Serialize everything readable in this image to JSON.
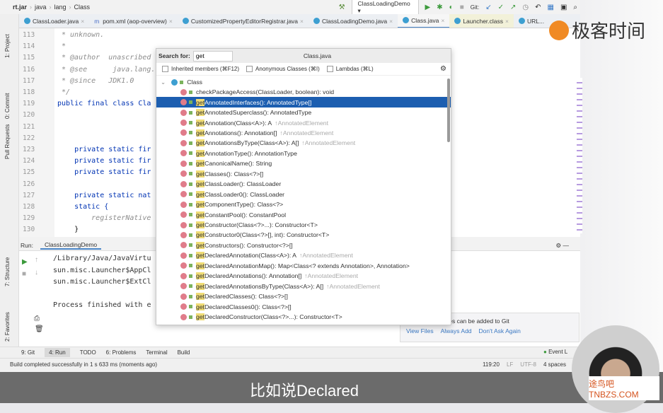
{
  "breadcrumb": [
    "rt.jar",
    "java",
    "lang",
    "Class"
  ],
  "toolbar": {
    "run_config": "ClassLoadingDemo ▾",
    "git_label": "Git:"
  },
  "tabs": [
    "ClassLoader.java",
    "pom.xml (aop-overview)",
    "CustomizedPropertyEditorRegistrar.java",
    "ClassLoadingDemo.java",
    "Class.java",
    "Launcher.class",
    "URL..."
  ],
  "side_tools": [
    "1: Project",
    "0: Commit",
    "Pull Requests",
    "7: Structure",
    "2: Favorites"
  ],
  "code": [
    {
      "n": "113",
      "t": "* unknown.",
      "c": "cm"
    },
    {
      "n": "114",
      "t": "*",
      "c": "cm"
    },
    {
      "n": "115",
      "t": "* @author  unascribed",
      "c": "cm"
    },
    {
      "n": "116",
      "t": "* @see      java.lang.",
      "c": "cm"
    },
    {
      "n": "117",
      "t": "* @since   JDK1.0",
      "c": "cm"
    },
    {
      "n": "118",
      "t": "*/",
      "c": "cm"
    },
    {
      "n": "119",
      "t": "public final class Cla",
      "c": "kw0"
    },
    {
      "n": "120",
      "t": "",
      "c": ""
    },
    {
      "n": "121",
      "t": "",
      "c": ""
    },
    {
      "n": "122",
      "t": "",
      "c": ""
    },
    {
      "n": "123",
      "t": "    private static fir",
      "c": "kw"
    },
    {
      "n": "124",
      "t": "    private static fir",
      "c": "kw"
    },
    {
      "n": "125",
      "t": "    private static fir",
      "c": "kw"
    },
    {
      "n": "126",
      "t": "",
      "c": ""
    },
    {
      "n": "127",
      "t": "    private static nat",
      "c": "kw"
    },
    {
      "n": "128",
      "t": "    static {",
      "c": "kw"
    },
    {
      "n": "129",
      "t": "        registerNative",
      "c": "cm"
    },
    {
      "n": "130",
      "t": "    }",
      "c": ""
    }
  ],
  "run": {
    "label": "Run:",
    "tab": "ClassLoadingDemo",
    "output": [
      "/Library/Java/JavaVirtu",
      "sun.misc.Launcher$AppCl",
      "sun.misc.Launcher$ExtCl",
      "",
      "Process finished with e"
    ]
  },
  "bottom_tools": [
    "9: Git",
    "4: Run",
    "TODO",
    "6: Problems",
    "Terminal",
    "Build"
  ],
  "event_log": "Event L",
  "status": {
    "message": "Build completed successfully in 1 s 633 ms (moments ago)",
    "position": "119:20",
    "line_sep": "LF",
    "encoding": "UTF-8",
    "indent": "4 spaces"
  },
  "popup": {
    "search_label": "Search for:",
    "search_value": "get",
    "file": "Class.java",
    "checks": [
      "Inherited members (⌘F12)",
      "Anonymous Classes (⌘I)",
      "Lambdas (⌘L)"
    ],
    "root": "Class",
    "items": [
      {
        "name": "checkPackageAccess(ClassLoader, boolean): void",
        "hl": "",
        "inh": ""
      },
      {
        "hl": "get",
        "name": "AnnotatedInterfaces(): AnnotatedType[]",
        "inh": "",
        "sel": true
      },
      {
        "hl": "get",
        "name": "AnnotatedSuperclass(): AnnotatedType",
        "inh": ""
      },
      {
        "hl": "get",
        "name": "Annotation(Class<A>): A",
        "inh": "↑AnnotatedElement"
      },
      {
        "hl": "get",
        "name": "Annotations(): Annotation[]",
        "inh": "↑AnnotatedElement"
      },
      {
        "hl": "get",
        "name": "AnnotationsByType(Class<A>): A[]",
        "inh": "↑AnnotatedElement"
      },
      {
        "hl": "get",
        "name": "AnnotationType(): AnnotationType",
        "inh": ""
      },
      {
        "hl": "get",
        "name": "CanonicalName(): String",
        "inh": ""
      },
      {
        "hl": "get",
        "name": "Classes(): Class<?>[]",
        "inh": ""
      },
      {
        "hl": "get",
        "name": "ClassLoader(): ClassLoader",
        "inh": ""
      },
      {
        "hl": "get",
        "name": "ClassLoader0(): ClassLoader",
        "inh": ""
      },
      {
        "hl": "get",
        "name": "ComponentType(): Class<?>",
        "inh": ""
      },
      {
        "hl": "get",
        "name": "ConstantPool(): ConstantPool",
        "inh": ""
      },
      {
        "hl": "get",
        "name": "Constructor(Class<?>...): Constructor<T>",
        "inh": ""
      },
      {
        "hl": "get",
        "name": "Constructor0(Class<?>[], int): Constructor<T>",
        "inh": ""
      },
      {
        "hl": "get",
        "name": "Constructors(): Constructor<?>[]",
        "inh": ""
      },
      {
        "hl": "get",
        "name": "DeclaredAnnotation(Class<A>): A",
        "inh": "↑AnnotatedElement"
      },
      {
        "hl": "get",
        "name": "DeclaredAnnotationMap(): Map<Class<? extends Annotation>, Annotation>",
        "inh": ""
      },
      {
        "hl": "get",
        "name": "DeclaredAnnotations(): Annotation[]",
        "inh": "↑AnnotatedElement"
      },
      {
        "hl": "get",
        "name": "DeclaredAnnotationsByType(Class<A>): A[]",
        "inh": "↑AnnotatedElement"
      },
      {
        "hl": "get",
        "name": "DeclaredClasses(): Class<?>[]",
        "inh": ""
      },
      {
        "hl": "get",
        "name": "DeclaredClasses0(): Class<?>[]",
        "inh": ""
      },
      {
        "hl": "get",
        "name": "DeclaredConstructor(Class<?>...): Constructor<T>",
        "inh": ""
      }
    ]
  },
  "notification": {
    "text": "d files can be added to Git",
    "actions": [
      "View Files",
      "Always Add",
      "Don't Ask Again"
    ]
  },
  "watermark": "极客时间",
  "watermark2": "途鸟吧 TNBZS.COM",
  "subtitle": "比如说Declared",
  "colors": {
    "selection": "#1c5eb0",
    "match_highlight": "#f0dc75",
    "keyword": "#0033b3"
  }
}
